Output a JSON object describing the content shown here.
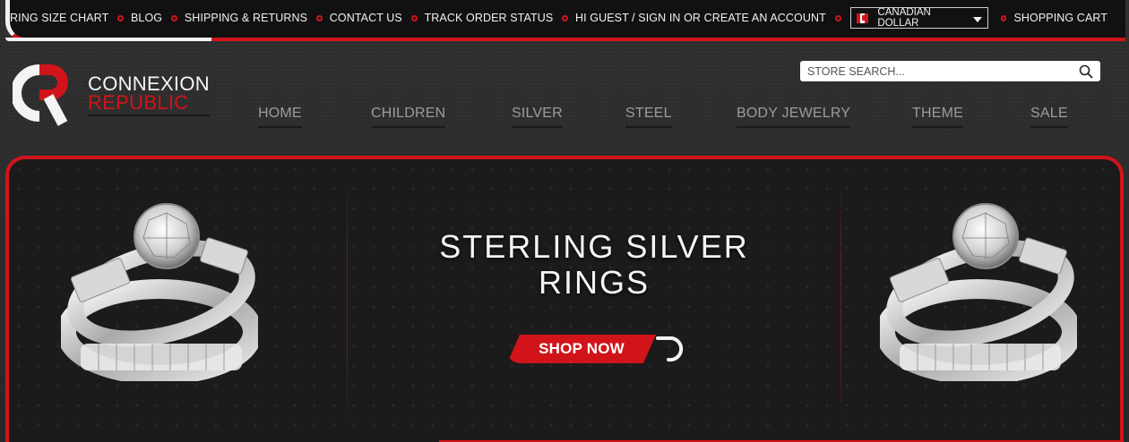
{
  "topbar": {
    "links": [
      {
        "label": "RING SIZE CHART"
      },
      {
        "label": "BLOG"
      },
      {
        "label": "SHIPPING & RETURNS"
      },
      {
        "label": "CONTACT US"
      },
      {
        "label": "TRACK ORDER STATUS"
      },
      {
        "label": "HI GUEST / SIGN IN OR CREATE AN ACCOUNT"
      }
    ],
    "currency": {
      "label": "CANADIAN DOLLAR",
      "icon": "canada-flag-icon"
    },
    "cart_label": "SHOPPING CART"
  },
  "logo": {
    "line1": "CONNEXION",
    "line2": "REPUBLIC"
  },
  "search": {
    "placeholder": "STORE SEARCH...",
    "icon": "search-icon"
  },
  "nav": {
    "items": [
      {
        "label": "HOME"
      },
      {
        "label": "CHILDREN"
      },
      {
        "label": "SILVER"
      },
      {
        "label": "STEEL"
      },
      {
        "label": "BODY JEWELRY"
      },
      {
        "label": "THEME"
      },
      {
        "label": "SALE"
      }
    ]
  },
  "hero": {
    "title_line1": "STERLING SILVER",
    "title_line2": "RINGS",
    "cta_label": "SHOP NOW"
  },
  "colors": {
    "accent": "#d0141a",
    "background": "#2b2b2b",
    "nav_text": "#9c9c9c"
  }
}
